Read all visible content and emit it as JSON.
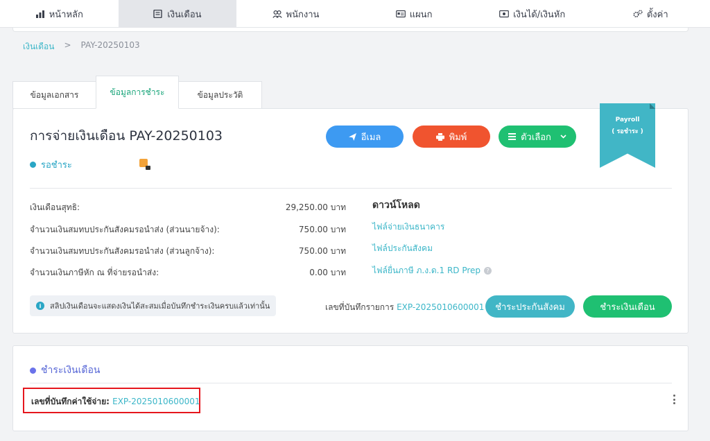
{
  "nav": [
    {
      "label": "หน้าหลัก",
      "icon": "bar-chart-icon",
      "active": false
    },
    {
      "label": "เงินเดือน",
      "icon": "payroll-icon",
      "active": true
    },
    {
      "label": "พนักงาน",
      "icon": "users-icon",
      "active": false
    },
    {
      "label": "แผนก",
      "icon": "id-card-icon",
      "active": false
    },
    {
      "label": "เงินได้/เงินหัก",
      "icon": "money-icon",
      "active": false
    },
    {
      "label": "ตั้งค่า",
      "icon": "gears-icon",
      "active": false
    }
  ],
  "breadcrumb": {
    "parent": "เงินเดือน",
    "separator": ">",
    "current": "PAY-20250103"
  },
  "tabs": [
    "ข้อมูลเอกสาร",
    "ข้อมูลการชำระ",
    "ข้อมูลประวัติ"
  ],
  "main": {
    "title": "การจ่ายเงินเดือน PAY-20250103",
    "status": "รอชำระ",
    "buttons": {
      "email": "อีเมล",
      "print": "พิมพ์",
      "options": "ตัวเลือก"
    },
    "ribbon": {
      "line1": "Payroll",
      "line2": "( รอชำระ )"
    },
    "rows": [
      {
        "label": "เงินเดือนสุทธิ:",
        "value": "29,250.00 บาท"
      },
      {
        "label": "จำนวนเงินสมทบประกันสังคมรอนำส่ง (ส่วนนายจ้าง):",
        "value": "750.00 บาท"
      },
      {
        "label": "จำนวนเงินสมทบประกันสังคมรอนำส่ง (ส่วนลูกจ้าง):",
        "value": "750.00 บาท"
      },
      {
        "label": "จำนวนเงินภาษีหัก ณ ที่จ่ายรอนำส่ง:",
        "value": "0.00 บาท"
      }
    ],
    "download": {
      "title": "ดาวน์โหลด",
      "links": [
        "ไฟล์จ่ายเงินธนาคาร",
        "ไฟล์ประกันสังคม",
        "ไฟล์ยื่นภาษี ภ.ง.ด.1 RD Prep"
      ],
      "help": "?"
    },
    "info": "สลิปเงินเดือนจะแสดงเงินได้สะสมเมื่อบันทึกชำระเงินครบแล้วเท่านั้น",
    "expense_ref_label": "เลขที่บันทึกรายการ",
    "expense_ref": "EXP-2025010600001",
    "btn_social": "ชำระประกันสังคม",
    "btn_pay": "ชำระเงินเดือน"
  },
  "payment_section": {
    "title": "ชำระเงินเดือน",
    "expense_label": "เลขที่บันทึกค่าใช้จ่าย:",
    "expense_ref": "EXP-2025010600001"
  },
  "colors": {
    "accent": "#3bb6c8",
    "email": "#3d9af2",
    "print": "#f0542f",
    "green": "#1fc072",
    "highlight": "#e5161d"
  }
}
